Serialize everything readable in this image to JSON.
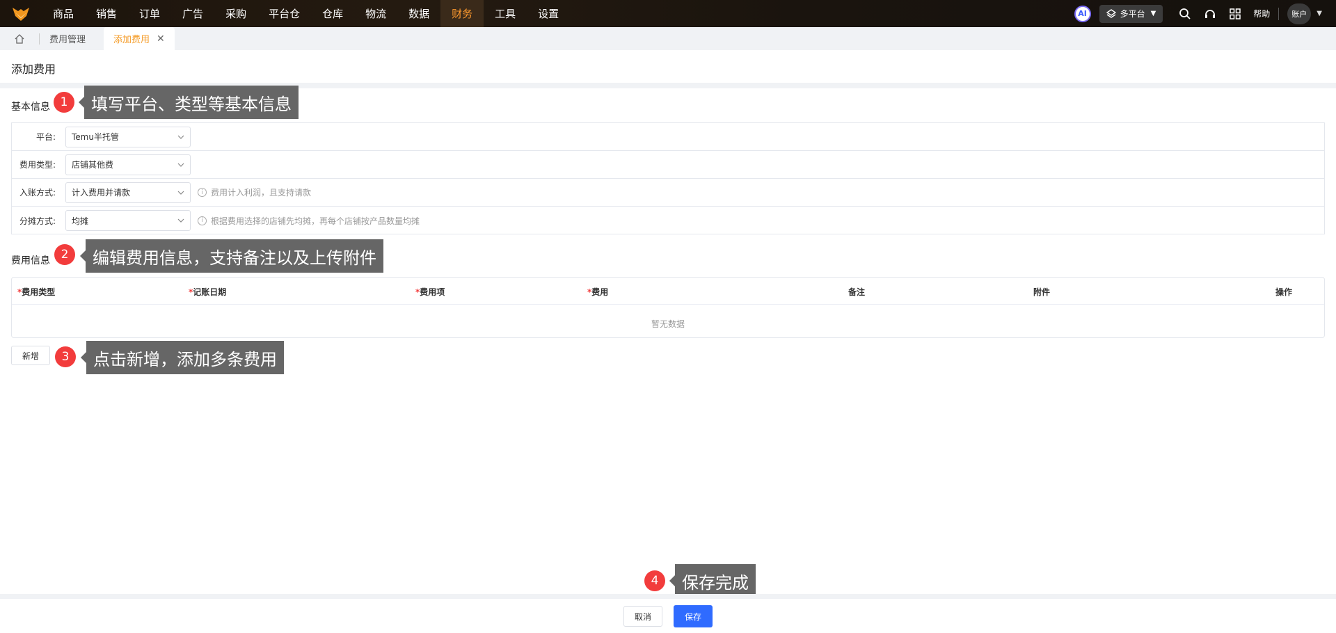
{
  "nav": {
    "items": [
      "商品",
      "销售",
      "订单",
      "广告",
      "采购",
      "平台仓",
      "仓库",
      "物流",
      "数据",
      "财务",
      "工具",
      "设置"
    ],
    "active": "财务",
    "ai_label": "AI",
    "platform": "多平台",
    "help": "帮助",
    "account": "账户"
  },
  "tabs": {
    "t1": "费用管理",
    "t2": "添加费用"
  },
  "page": {
    "title": "添加费用"
  },
  "basic": {
    "title": "基本信息",
    "platform_label": "平台:",
    "platform_value": "Temu半托管",
    "type_label": "费用类型:",
    "type_value": "店铺其他费",
    "entry_label": "入账方式:",
    "entry_value": "计入费用并请款",
    "entry_hint": "费用计入利润，且支持请款",
    "split_label": "分摊方式:",
    "split_value": "均摊",
    "split_hint": "根据费用选择的店铺先均摊，再每个店铺按产品数量均摊"
  },
  "fee": {
    "title": "费用信息",
    "columns": [
      "费用类型",
      "记账日期",
      "费用项",
      "费用",
      "备注",
      "附件",
      "操作"
    ],
    "required_mark": "*",
    "empty": "暂无数据",
    "add": "新增"
  },
  "callouts": {
    "c1_num": "1",
    "c1": "填写平台、类型等基本信息",
    "c2_num": "2",
    "c2": "编辑费用信息，支持备注以及上传附件",
    "c3_num": "3",
    "c3": "点击新增，添加多条费用",
    "c4_num": "4",
    "c4": "保存完成"
  },
  "footer": {
    "cancel": "取消",
    "save": "保存"
  }
}
